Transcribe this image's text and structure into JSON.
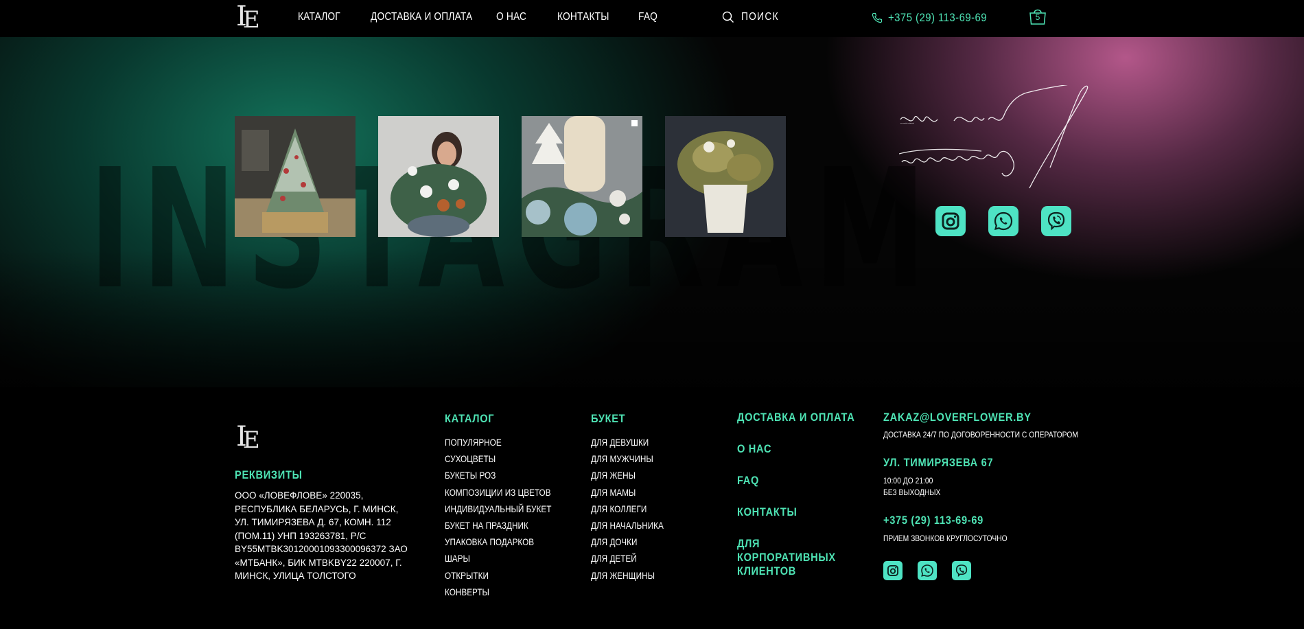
{
  "header": {
    "logo_text": "LE",
    "nav": [
      "КАТАЛОГ",
      "ДОСТАВКА И ОПЛАТА",
      "О НАС",
      "КОНТАКТЫ",
      "FAQ"
    ],
    "search_label": "ПОИСК",
    "phone": "+375 (29) 113-69-69",
    "cart_count": "5"
  },
  "hero": {
    "background_word": "INSTAGRAM",
    "tagline": "our social networks",
    "social_icons": [
      "instagram-icon",
      "whatsapp-icon",
      "viber-icon"
    ]
  },
  "footer": {
    "logo_text": "LE",
    "requisites_title": "РЕКВИЗИТЫ",
    "requisites_text": "ООО «ЛОВЕФЛОВЕ» 220035, РЕСПУБЛИКА БЕЛАРУСЬ, Г. МИНСК, УЛ. ТИМИРЯЗЕВА Д. 67, КОМН. 112 (ПОМ.11) УНП 193263781, Р/С BY55MTBK30120001093300096372 ЗАО «МТБАНК», БИК MTBKBY22 220007, Г. МИНСК, УЛИЦА ТОЛСТОГО",
    "catalog": {
      "title": "КАТАЛОГ",
      "items": [
        "ПОПУЛЯРНОЕ",
        "СУХОЦВЕТЫ",
        "БУКЕТЫ РОЗ",
        "КОМПОЗИЦИИ ИЗ ЦВЕТОВ",
        "ИНДИВИДУАЛЬНЫЙ БУКЕТ",
        "БУКЕТ НА ПРАЗДНИК",
        "УПАКОВКА ПОДАРКОВ",
        "ШАРЫ",
        "ОТКРЫТКИ",
        "КОНВЕРТЫ"
      ]
    },
    "bouquet": {
      "title": "БУКЕТ",
      "items": [
        "ДЛЯ ДЕВУШКИ",
        "ДЛЯ МУЖЧИНЫ",
        "ДЛЯ ЖЕНЫ",
        "ДЛЯ МАМЫ",
        "ДЛЯ КОЛЛЕГИ",
        "ДЛЯ НАЧАЛЬНИКА",
        "ДЛЯ ДОЧКИ",
        "ДЛЯ ДЕТЕЙ",
        "ДЛЯ ЖЕНЩИНЫ"
      ]
    },
    "links": [
      "ДОСТАВКА И ОПЛАТА",
      "О НАС",
      "FAQ",
      "КОНТАКТЫ",
      "ДЛЯ КОРПОРАТИВНЫХ КЛИЕНТОВ"
    ],
    "contacts": {
      "email": "ZAKAZ@LOVERFLOWER.BY",
      "email_note": "ДОСТАВКА 24/7 ПО ДОГОВОРЕННОСТИ С ОПЕРАТОРОМ",
      "address": "УЛ. ТИМИРЯЗЕВА 67",
      "hours": "10:00 ДО 21:00",
      "days": "БЕЗ ВЫХОДНЫХ",
      "phone": "+375 (29) 113-69-69",
      "phone_note": "ПРИЕМ ЗВОНКОВ КРУГЛОСУТОЧНО"
    }
  },
  "colors": {
    "accent": "#4ee3b4",
    "pink": "#c66098",
    "green": "#14785f"
  }
}
